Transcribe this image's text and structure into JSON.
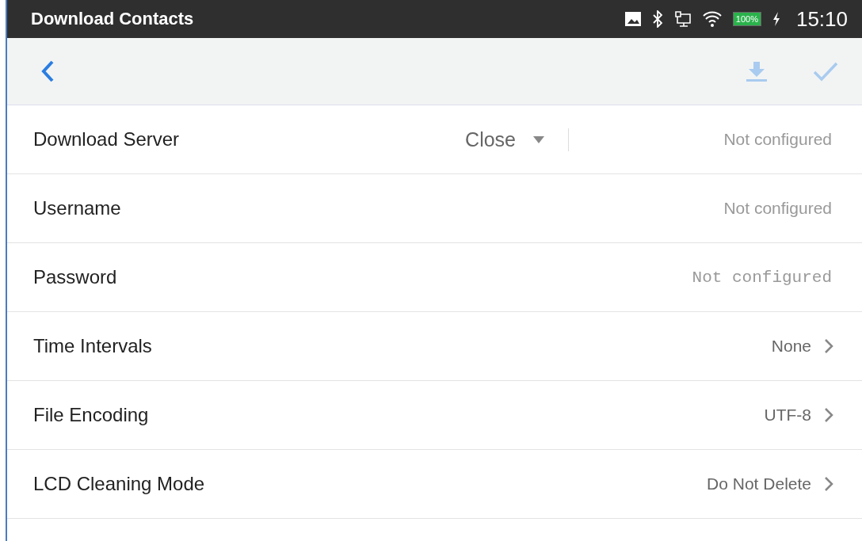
{
  "status_bar": {
    "title": "Download Contacts",
    "battery": "100%",
    "time": "15:10"
  },
  "rows": [
    {
      "kind": "dropdown",
      "label": "Download Server",
      "value": "Close",
      "placeholder": "Not configured"
    },
    {
      "kind": "text",
      "label": "Username",
      "placeholder": "Not configured"
    },
    {
      "kind": "password",
      "label": "Password",
      "placeholder": "Not configured"
    },
    {
      "kind": "link",
      "label": "Time Intervals",
      "value": "None"
    },
    {
      "kind": "link",
      "label": "File Encoding",
      "value": "UTF-8"
    },
    {
      "kind": "link",
      "label": "LCD Cleaning Mode",
      "value": "Do Not Delete"
    }
  ]
}
